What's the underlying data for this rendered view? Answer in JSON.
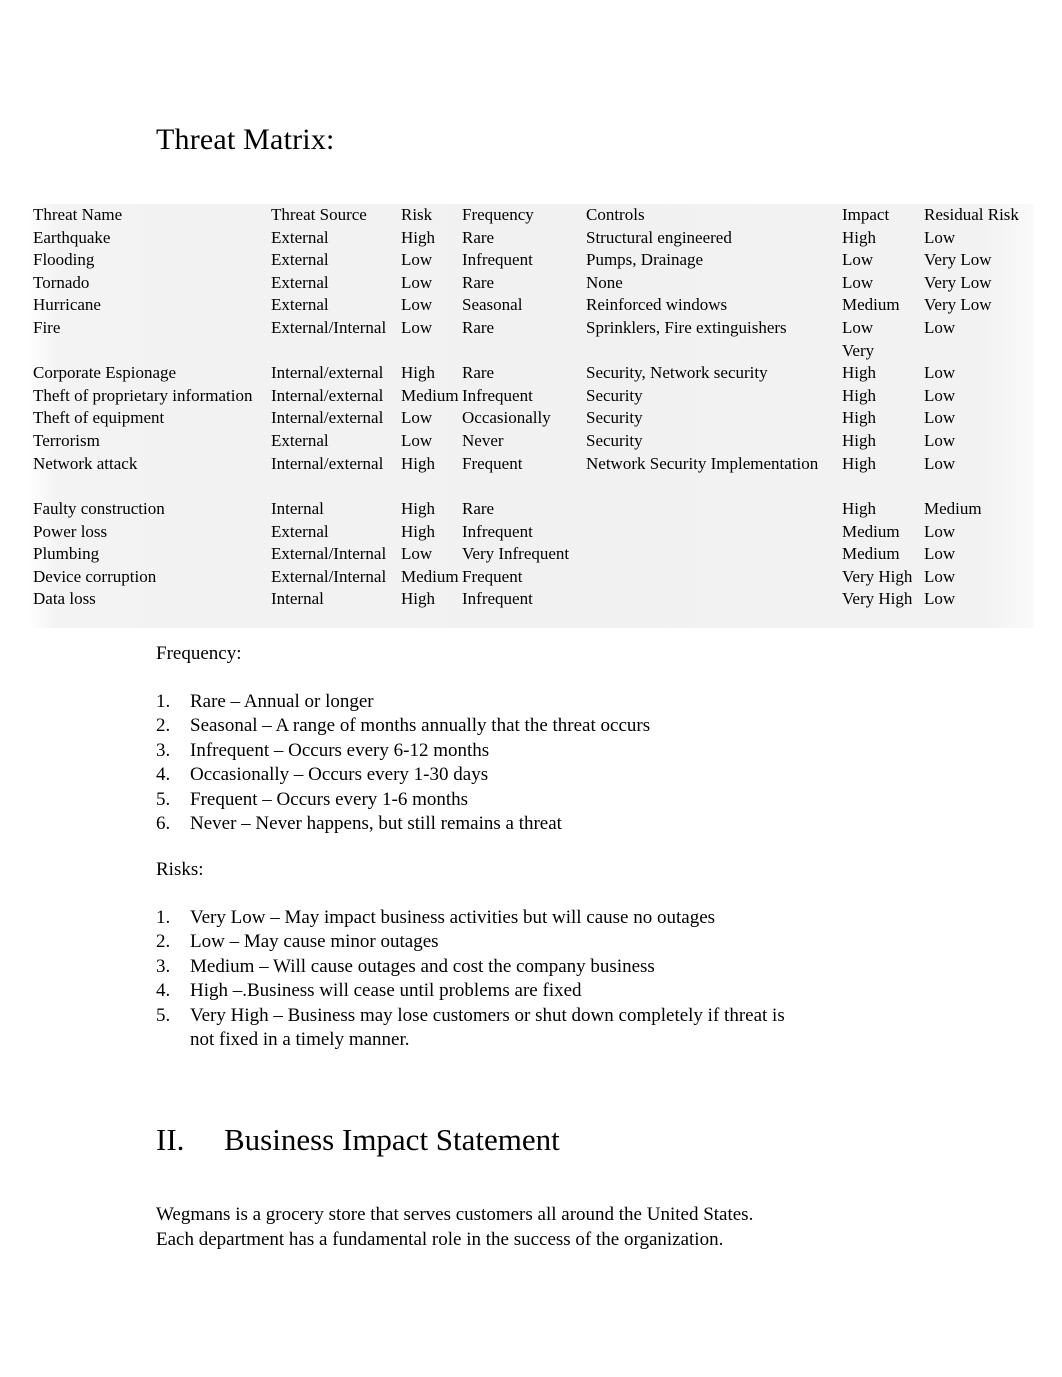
{
  "document": {
    "title": "Threat Matrix:"
  },
  "matrix": {
    "columns": [
      "Threat Name",
      "Threat Source",
      "Risk",
      "Frequency",
      "Controls",
      "Impact",
      "Residual Risk"
    ],
    "rows": [
      {
        "name": "Earthquake",
        "source": "External",
        "risk": "High",
        "frequency": "Rare",
        "controls": "Structural engineered",
        "impact": "High",
        "residual": "Low"
      },
      {
        "name": "Flooding",
        "source": "External",
        "risk": "Low",
        "frequency": "Infrequent",
        "controls": "Pumps, Drainage",
        "impact": "Low",
        "residual": "Very Low"
      },
      {
        "name": "Tornado",
        "source": "External",
        "risk": "Low",
        "frequency": "Rare",
        "controls": "None",
        "impact": "Low",
        "residual": "Very Low"
      },
      {
        "name": "Hurricane",
        "source": "External",
        "risk": "Low",
        "frequency": "Seasonal",
        "controls": "Reinforced windows",
        "impact": "Medium",
        "residual": "Very Low"
      },
      {
        "name": "Fire",
        "source": "External/Internal",
        "risk": "Low",
        "frequency": "Rare",
        "controls": "Sprinklers, Fire extinguishers",
        "impact": "Low",
        "impact_wrap": "Very",
        "residual": "Low"
      },
      {
        "name": "Corporate Espionage",
        "source": "Internal/external",
        "risk": "High",
        "frequency": "Rare",
        "controls": "Security, Network security",
        "impact": "High",
        "residual": "Low"
      },
      {
        "name": "Theft of proprietary information",
        "source": "Internal/external",
        "risk": "Medium",
        "frequency": "Infrequent",
        "controls": "Security",
        "impact": "High",
        "residual": "Low"
      },
      {
        "name": "Theft of equipment",
        "source": "Internal/external",
        "risk": "Low",
        "frequency": "Occasionally",
        "controls": "Security",
        "impact": "High",
        "residual": "Low"
      },
      {
        "name": "Terrorism",
        "source": "External",
        "risk": "Low",
        "frequency": "Never",
        "controls": "Security",
        "impact": "High",
        "residual": "Low"
      },
      {
        "name": "Network attack",
        "source": "Internal/external",
        "risk": "High",
        "frequency": "Frequent",
        "controls": "Network Security Implementation",
        "impact": "High",
        "residual": "Low"
      },
      {
        "name": "Faulty construction",
        "source": "Internal",
        "risk": "High",
        "frequency": "Rare",
        "controls": "",
        "impact": "High",
        "residual": "Medium"
      },
      {
        "name": "Power loss",
        "source": "External",
        "risk": "High",
        "frequency": "Infrequent",
        "controls": "",
        "impact": "Medium",
        "residual": "Low"
      },
      {
        "name": "Plumbing",
        "source": "External/Internal",
        "risk": "Low",
        "frequency": "Very Infrequent",
        "controls": "",
        "impact": "Medium",
        "residual": "Low"
      },
      {
        "name": "Device corruption",
        "source": "External/Internal",
        "risk": "Medium",
        "frequency": "Frequent",
        "controls": "",
        "impact": "Very High",
        "residual": "Low"
      },
      {
        "name": "Data loss",
        "source": "Internal",
        "risk": "High",
        "frequency": "Infrequent",
        "controls": "",
        "impact": "Very High",
        "residual": "Low"
      }
    ]
  },
  "frequency_section": {
    "heading": "Frequency:",
    "items": [
      {
        "num": "1.",
        "text": "Rare – Annual or longer"
      },
      {
        "num": "2.",
        "text": "Seasonal – A range of months annually that the threat occurs"
      },
      {
        "num": "3.",
        "text": "Infrequent – Occurs every 6-12 months"
      },
      {
        "num": "4.",
        "text": "Occasionally – Occurs every 1-30 days"
      },
      {
        "num": "5.",
        "text": "Frequent – Occurs every 1-6 months"
      },
      {
        "num": "6.",
        "text": "Never – Never happens, but still remains a threat"
      }
    ]
  },
  "risks_section": {
    "heading": "Risks:",
    "items": [
      {
        "num": "1.",
        "text": "Very Low – May impact business activities but will cause no outages"
      },
      {
        "num": "2.",
        "text": "Low – May cause minor outages"
      },
      {
        "num": "3.",
        "text": "Medium – Will cause outages and cost the company business"
      },
      {
        "num": "4.",
        "text": "High –.Business will cease until problems are fixed"
      },
      {
        "num": "5.",
        "text": "Very High – Business may lose customers or shut down completely if threat is",
        "text2": "not fixed in a timely manner."
      }
    ]
  },
  "section_two": {
    "number": "II.",
    "heading": "Business Impact Statement",
    "paragraph_line1": "Wegmans is a grocery store that serves customers all around the United States.",
    "paragraph_line2": "Each department has a fundamental role in the success of the organization."
  }
}
